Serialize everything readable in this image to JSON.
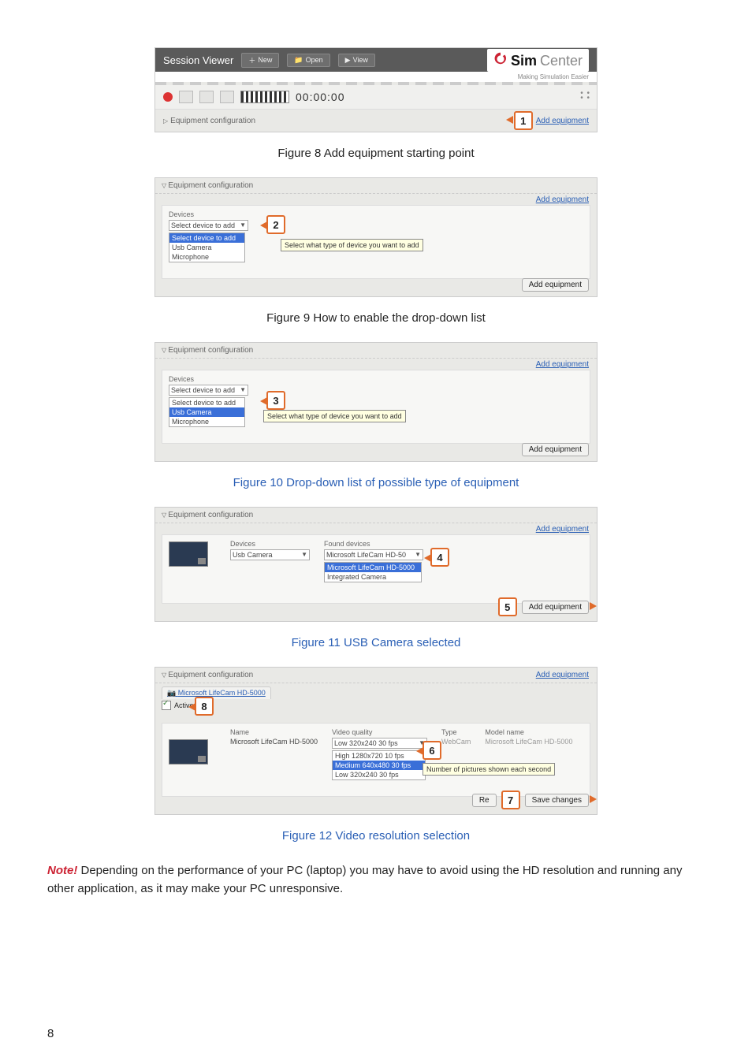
{
  "fig8": {
    "session_title": "Session Viewer",
    "btn_new": "New",
    "btn_open": "Open",
    "btn_view": "View",
    "logo_bold": "Sim",
    "logo_light": "Center",
    "logo_tag": "Making Simulation Easier",
    "time": "00:00:00",
    "eq_label": "Equipment configuration",
    "add_link": "Add equipment",
    "callout": "1",
    "caption": "Figure 8 Add equipment starting point"
  },
  "fig9": {
    "eq_label": "Equipment configuration",
    "add_link": "Add equipment",
    "devices_hdr": "Devices",
    "sel_placeholder": "Select device to add",
    "opt0": "Select device to add",
    "opt1": "Usb Camera",
    "opt2": "Microphone",
    "tooltip": "Select what type of device you want to add",
    "add_btn": "Add equipment",
    "callout": "2",
    "caption": "Figure 9 How to enable the drop-down list"
  },
  "fig10": {
    "eq_label": "Equipment configuration",
    "add_link": "Add equipment",
    "devices_hdr": "Devices",
    "sel_placeholder": "Select device to add",
    "opt0": "Select device to add",
    "opt1": "Usb Camera",
    "opt2": "Microphone",
    "tooltip": "Select what type of device you want to add",
    "add_btn": "Add equipment",
    "callout": "3",
    "caption": "Figure 10 Drop-down list of possible type of equipment"
  },
  "fig11": {
    "eq_label": "Equipment configuration",
    "add_link": "Add equipment",
    "devices_hdr": "Devices",
    "devices_val": "Usb Camera",
    "found_hdr": "Found devices",
    "found_sel": "Microsoft LifeCam HD-50",
    "found_opt_hi": "Microsoft LifeCam HD-5000",
    "found_opt2": "Integrated Camera",
    "add_btn": "Add equipment",
    "callout4": "4",
    "callout5": "5",
    "caption": "Figure 11 USB Camera selected"
  },
  "fig12": {
    "eq_label": "Equipment configuration",
    "tab_name": "Microsoft LifeCam HD-5000",
    "active_lbl": "Active",
    "add_link": "Add equipment",
    "col_name": "Name",
    "col_name_val": "Microsoft LifeCam HD-5000",
    "col_vq": "Video quality",
    "vq_sel": "Low 320x240 30 fps",
    "vq_opt0": "High 1280x720 10 fps",
    "vq_opt1": "Medium 640x480 30 fps",
    "vq_opt2": "Low 320x240 30 fps",
    "col_type": "Type",
    "col_type_val": "WebCam",
    "col_model": "Model name",
    "col_model_val": "Microsoft LifeCam HD-5000",
    "tooltip": "Number of pictures shown each second",
    "reset_btn": "Re",
    "save_btn": "Save changes",
    "callout6": "6",
    "callout7": "7",
    "callout8": "8",
    "caption": "Figure 12 Video resolution selection"
  },
  "note": {
    "label": "Note!",
    "text": " Depending on the performance of your PC (laptop) you may have to avoid using the HD resolution and running any other application, as it may make your PC unresponsive."
  },
  "page_number": "8"
}
